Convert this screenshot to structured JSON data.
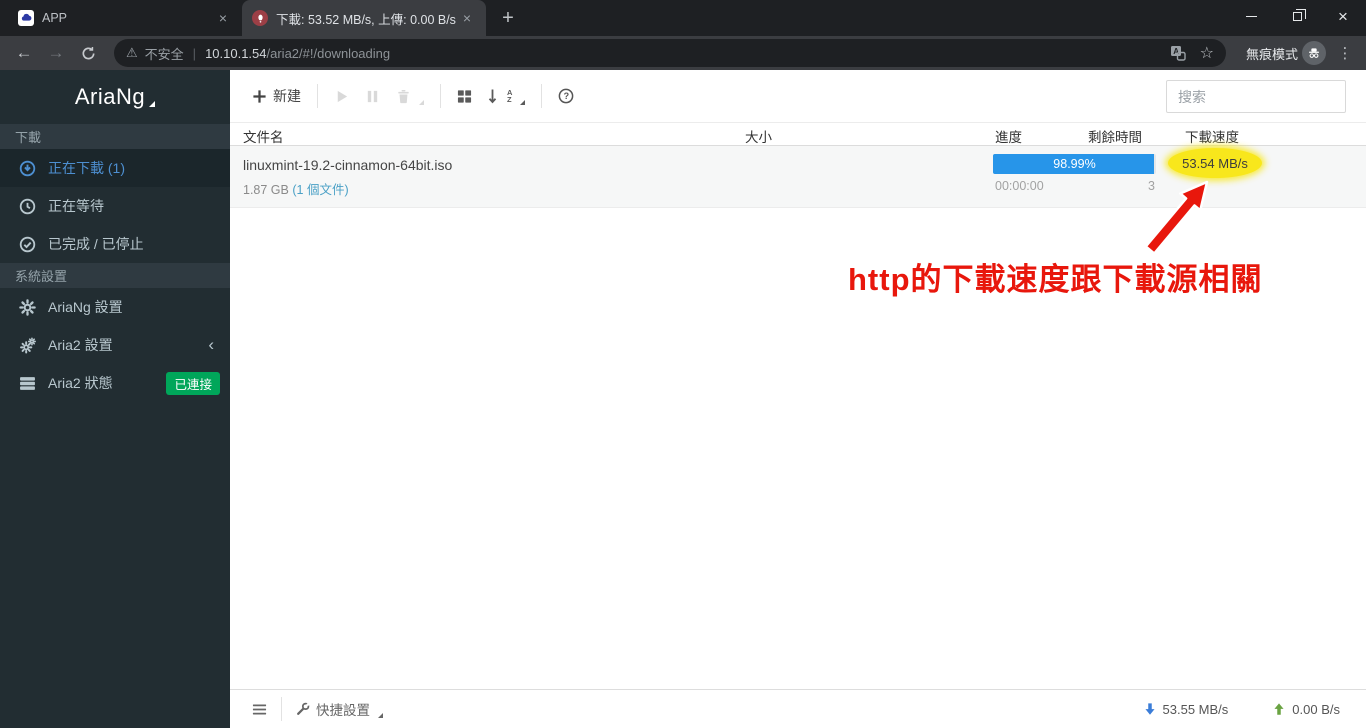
{
  "browser": {
    "tabs": [
      {
        "title": "APP"
      },
      {
        "title": "下載: 53.52 MB/s, 上傳: 0.00 B/s"
      }
    ],
    "address": {
      "security_label": "不安全",
      "url_host": "10.10.1.54",
      "url_path": "/aria2/#!/downloading",
      "incognito_label": "無痕模式"
    }
  },
  "icons": {
    "back": "←",
    "forward": "→",
    "star": "☆",
    "more": "⋮",
    "warning": "⚠",
    "close": "×",
    "plus": "+",
    "chevron_left": "‹",
    "pipe": "|"
  },
  "sidebar": {
    "logo": "AriaNg",
    "sections": [
      {
        "header": "下載",
        "items": [
          {
            "label": "正在下載 (1)"
          },
          {
            "label": "正在等待"
          },
          {
            "label": "已完成 / 已停止"
          }
        ]
      },
      {
        "header": "系統設置",
        "items": [
          {
            "label": "AriaNg 設置"
          },
          {
            "label": "Aria2 設置"
          },
          {
            "label": "Aria2 狀態",
            "badge": "已連接"
          }
        ]
      }
    ]
  },
  "toolbar": {
    "new_label": "新建",
    "search_placeholder": "搜索"
  },
  "table": {
    "headers": [
      "文件名",
      "大小",
      "進度",
      "剩餘時間",
      "下載速度"
    ]
  },
  "task": {
    "name": "linuxmint-19.2-cinnamon-64bit.iso",
    "size": "1.87 GB",
    "files_link": "(1 個文件)",
    "progress": "98.99%",
    "progress_percent": 98.99,
    "time_elapsed": "00:00:00",
    "connections": "3",
    "speed": "53.54 MB/s"
  },
  "annotation": {
    "text": "http的下載速度跟下載源相關"
  },
  "statusbar": {
    "quick_settings": "快捷設置",
    "download_speed": "53.55 MB/s",
    "upload_speed": "0.00 B/s"
  },
  "colors": {
    "accent_blue": "#2795e9",
    "highlight_yellow": "#f8e71c",
    "badge_green": "#00a65a",
    "annotation_red": "#e8170c",
    "link_blue": "#4aa0c6",
    "active_item_blue": "#4d8fd1",
    "sidebar_bg": "#222d32"
  }
}
